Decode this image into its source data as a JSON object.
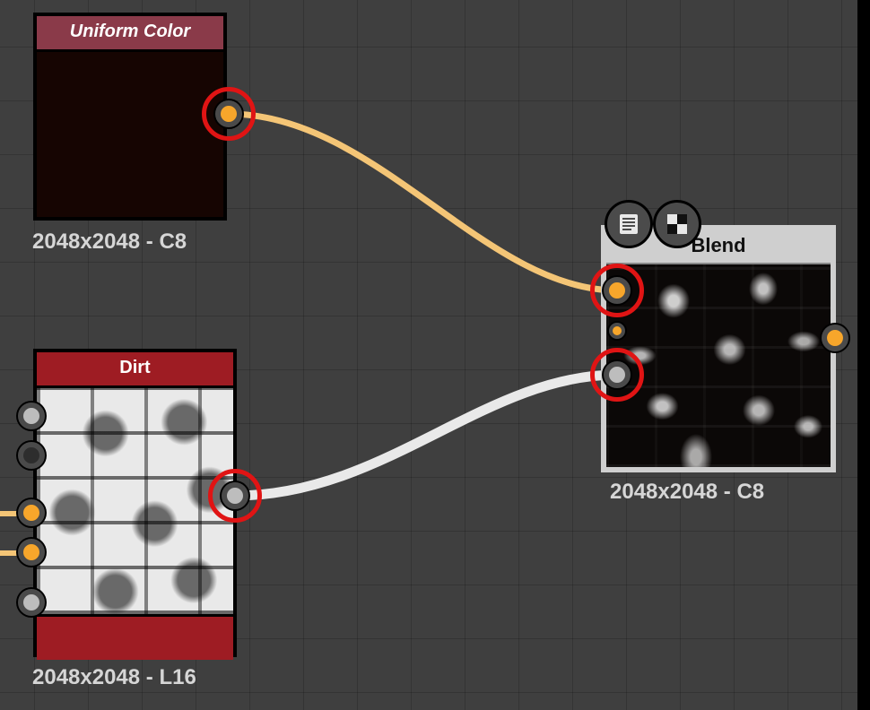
{
  "nodes": {
    "uniform_color": {
      "title": "Uniform Color",
      "info": "2048x2048 - C8",
      "header_color": "#8a3a49",
      "preview_color": "#160502"
    },
    "dirt": {
      "title": "Dirt",
      "info": "2048x2048 - L16",
      "header_color": "#9e1c23"
    },
    "blend": {
      "title": "Blend",
      "info": "2048x2048 - C8"
    }
  },
  "ports": {
    "uc_out": {
      "type": "color"
    },
    "dirt_in1": {
      "type": "grey"
    },
    "dirt_in2": {
      "type": "dark"
    },
    "dirt_in3": {
      "type": "color"
    },
    "dirt_in4": {
      "type": "color"
    },
    "dirt_in5": {
      "type": "grey"
    },
    "dirt_out": {
      "type": "grey"
    },
    "blend_in1": {
      "type": "color"
    },
    "blend_in2": {
      "type": "color_small"
    },
    "blend_in3": {
      "type": "grey"
    },
    "blend_out": {
      "type": "color"
    }
  },
  "actions": {
    "properties": "properties-icon",
    "view": "view-2d-icon"
  }
}
